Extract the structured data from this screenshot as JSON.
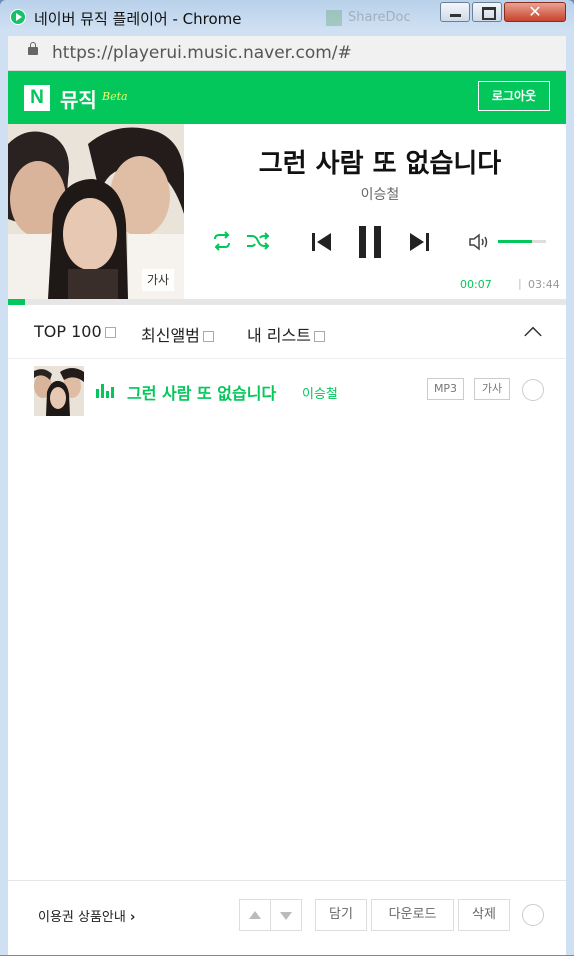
{
  "window": {
    "title": "네이버 뮤직 플레이어 - Chrome",
    "ghost_tab": "ShareDoc"
  },
  "address_bar": {
    "url": "https://playerui.music.naver.com/#"
  },
  "header": {
    "logo": "N",
    "brand": "뮤직",
    "beta": "Beta",
    "logout_label": "로그아웃"
  },
  "player": {
    "lyrics_button": "가사",
    "title": "그런 사람 또 없습니다",
    "artist": "이승철",
    "time_current": "00:07",
    "time_separator": "|",
    "time_total": "03:44",
    "progress_fraction": 0.03,
    "volume_fraction": 0.7,
    "accent_color": "#03c75a"
  },
  "tabs": [
    {
      "label": "TOP 100"
    },
    {
      "label": "최신앨범"
    },
    {
      "label": "내 리스트"
    }
  ],
  "playlist": [
    {
      "title": "그런 사람 또 없습니다",
      "artist": "이승철",
      "mp3_label": "MP3",
      "lyrics_label": "가사",
      "playing": true
    }
  ],
  "footer": {
    "voucher_label": "이용권 상품안내",
    "add_label": "담기",
    "download_label": "다운로드",
    "delete_label": "삭제"
  }
}
